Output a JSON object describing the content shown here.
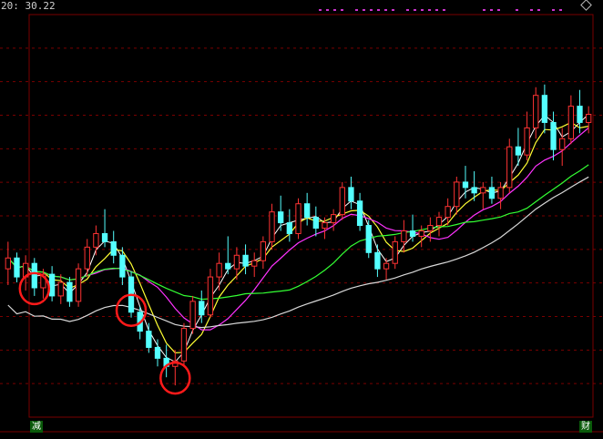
{
  "header": {
    "time_text": "20: 30.22"
  },
  "footer": {
    "left_badge": "减",
    "right_badge": "财"
  },
  "chart_data": {
    "type": "candlestick",
    "ylim": [
      0,
      100
    ],
    "grid": true,
    "candles": [
      {
        "o": 58,
        "h": 68,
        "l": 52,
        "c": 62
      },
      {
        "o": 62,
        "h": 64,
        "l": 53,
        "c": 55
      },
      {
        "o": 55,
        "h": 63,
        "l": 50,
        "c": 60
      },
      {
        "o": 60,
        "h": 62,
        "l": 48,
        "c": 51
      },
      {
        "o": 51,
        "h": 58,
        "l": 47,
        "c": 56
      },
      {
        "o": 56,
        "h": 59,
        "l": 46,
        "c": 48
      },
      {
        "o": 48,
        "h": 56,
        "l": 45,
        "c": 53
      },
      {
        "o": 53,
        "h": 55,
        "l": 44,
        "c": 46
      },
      {
        "o": 46,
        "h": 60,
        "l": 44,
        "c": 58
      },
      {
        "o": 58,
        "h": 69,
        "l": 55,
        "c": 66
      },
      {
        "o": 66,
        "h": 74,
        "l": 63,
        "c": 71
      },
      {
        "o": 71,
        "h": 80,
        "l": 66,
        "c": 68
      },
      {
        "o": 68,
        "h": 72,
        "l": 60,
        "c": 63
      },
      {
        "o": 63,
        "h": 66,
        "l": 52,
        "c": 55
      },
      {
        "o": 55,
        "h": 57,
        "l": 40,
        "c": 42
      },
      {
        "o": 42,
        "h": 44,
        "l": 32,
        "c": 35
      },
      {
        "o": 35,
        "h": 38,
        "l": 27,
        "c": 29
      },
      {
        "o": 29,
        "h": 32,
        "l": 22,
        "c": 25
      },
      {
        "o": 25,
        "h": 30,
        "l": 18,
        "c": 22
      },
      {
        "o": 22,
        "h": 28,
        "l": 15,
        "c": 24
      },
      {
        "o": 24,
        "h": 38,
        "l": 22,
        "c": 36
      },
      {
        "o": 36,
        "h": 48,
        "l": 34,
        "c": 46
      },
      {
        "o": 46,
        "h": 50,
        "l": 38,
        "c": 41
      },
      {
        "o": 41,
        "h": 58,
        "l": 40,
        "c": 55
      },
      {
        "o": 55,
        "h": 64,
        "l": 50,
        "c": 60
      },
      {
        "o": 60,
        "h": 70,
        "l": 56,
        "c": 58
      },
      {
        "o": 58,
        "h": 66,
        "l": 54,
        "c": 63
      },
      {
        "o": 63,
        "h": 67,
        "l": 56,
        "c": 59
      },
      {
        "o": 59,
        "h": 64,
        "l": 55,
        "c": 61
      },
      {
        "o": 61,
        "h": 70,
        "l": 58,
        "c": 68
      },
      {
        "o": 68,
        "h": 82,
        "l": 65,
        "c": 79
      },
      {
        "o": 79,
        "h": 85,
        "l": 72,
        "c": 75
      },
      {
        "o": 75,
        "h": 80,
        "l": 68,
        "c": 71
      },
      {
        "o": 71,
        "h": 84,
        "l": 69,
        "c": 82
      },
      {
        "o": 82,
        "h": 86,
        "l": 74,
        "c": 77
      },
      {
        "o": 77,
        "h": 81,
        "l": 70,
        "c": 73
      },
      {
        "o": 73,
        "h": 77,
        "l": 69,
        "c": 75
      },
      {
        "o": 75,
        "h": 80,
        "l": 72,
        "c": 78
      },
      {
        "o": 78,
        "h": 90,
        "l": 76,
        "c": 88
      },
      {
        "o": 88,
        "h": 92,
        "l": 80,
        "c": 83
      },
      {
        "o": 83,
        "h": 86,
        "l": 72,
        "c": 74
      },
      {
        "o": 74,
        "h": 76,
        "l": 62,
        "c": 64
      },
      {
        "o": 64,
        "h": 67,
        "l": 55,
        "c": 58
      },
      {
        "o": 58,
        "h": 62,
        "l": 54,
        "c": 60
      },
      {
        "o": 60,
        "h": 70,
        "l": 58,
        "c": 68
      },
      {
        "o": 68,
        "h": 76,
        "l": 64,
        "c": 72
      },
      {
        "o": 72,
        "h": 78,
        "l": 68,
        "c": 70
      },
      {
        "o": 70,
        "h": 74,
        "l": 66,
        "c": 72
      },
      {
        "o": 72,
        "h": 77,
        "l": 68,
        "c": 74
      },
      {
        "o": 74,
        "h": 79,
        "l": 70,
        "c": 77
      },
      {
        "o": 77,
        "h": 84,
        "l": 74,
        "c": 81
      },
      {
        "o": 81,
        "h": 92,
        "l": 78,
        "c": 90
      },
      {
        "o": 90,
        "h": 96,
        "l": 84,
        "c": 88
      },
      {
        "o": 88,
        "h": 94,
        "l": 83,
        "c": 86
      },
      {
        "o": 86,
        "h": 90,
        "l": 80,
        "c": 88
      },
      {
        "o": 88,
        "h": 92,
        "l": 82,
        "c": 84
      },
      {
        "o": 84,
        "h": 90,
        "l": 80,
        "c": 88
      },
      {
        "o": 88,
        "h": 106,
        "l": 86,
        "c": 103
      },
      {
        "o": 103,
        "h": 110,
        "l": 96,
        "c": 100
      },
      {
        "o": 100,
        "h": 116,
        "l": 98,
        "c": 110
      },
      {
        "o": 110,
        "h": 125,
        "l": 106,
        "c": 122
      },
      {
        "o": 122,
        "h": 126,
        "l": 108,
        "c": 112
      },
      {
        "o": 112,
        "h": 116,
        "l": 98,
        "c": 102
      },
      {
        "o": 102,
        "h": 110,
        "l": 96,
        "c": 106
      },
      {
        "o": 106,
        "h": 122,
        "l": 104,
        "c": 118
      },
      {
        "o": 118,
        "h": 124,
        "l": 108,
        "c": 112
      },
      {
        "o": 112,
        "h": 118,
        "l": 108,
        "c": 115
      }
    ],
    "ma_series": [
      {
        "color": "#ffffff"
      },
      {
        "color": "#ffff33"
      },
      {
        "color": "#ff33ff"
      },
      {
        "color": "#33ff33"
      },
      {
        "color": "#d8d8d8"
      }
    ],
    "highlight_circles": [
      {
        "index": 3
      },
      {
        "index": 14
      },
      {
        "index": 19
      }
    ],
    "colors": {
      "up": "#ff3333",
      "down": "#54ffff",
      "grid": "#7a0000",
      "frame": "#7a0000",
      "circle": "#ff1a1a",
      "ticker_dot": "#cc33cc"
    }
  }
}
